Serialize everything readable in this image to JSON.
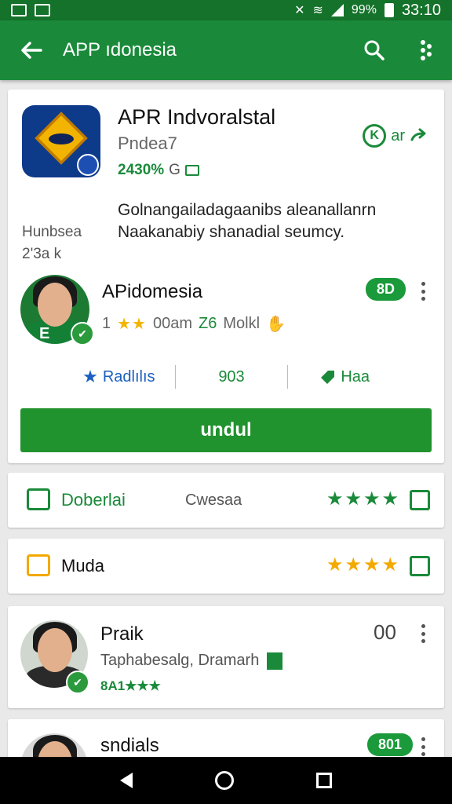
{
  "status_bar": {
    "clock": "33:10",
    "battery": "99%"
  },
  "app_bar": {
    "title": "APP ıdonesia",
    "icons": [
      "arrow-back-icon",
      "search-icon",
      "more-vertical-icon"
    ]
  },
  "app": {
    "title": "APR Indvoralstal",
    "subtitle": "Pndea7",
    "rating_text": "2430%",
    "rating_suffix": "G",
    "share_ring": "K",
    "share_label": "ar",
    "description_line1": "Golnangailadagaanibs aleanallanrn",
    "description_line2": "Naakanabiy shanadial seumcy.",
    "side_label": "Hunbsea",
    "side_value": "2'3a k"
  },
  "publisher": {
    "name": "APidomesia",
    "badge": "8D",
    "meta_prefix": "1",
    "meta_stars": "★★",
    "meta_text": "00am",
    "meta_green": "Z6",
    "meta_tail": "Molkl",
    "avatar_badge": "E"
  },
  "stats": {
    "left_label": "Radlılıs",
    "middle_label": "903",
    "right_label": "Haa"
  },
  "install_button": "undul",
  "rows": [
    {
      "label": "Doberlai",
      "middle": "Cwesaa",
      "stars": "★★★★",
      "accent": "#1a8a3a",
      "label_color": "#1a8a3a"
    },
    {
      "label": "Muda",
      "middle": "",
      "stars": "★★★★",
      "accent": "#f2a900",
      "label_color": "#111111"
    }
  ],
  "reviews": [
    {
      "name": "Praik",
      "subtitle": "Taphabesalg, Dramarh",
      "rating": "8A1★★★",
      "vote": "00"
    },
    {
      "name": "sndials",
      "badge": "801"
    }
  ],
  "colors": {
    "brand": "#1a8a3a",
    "brand_dark": "#14722a",
    "star": "#f2b400",
    "link_blue": "#1b5fbf"
  }
}
